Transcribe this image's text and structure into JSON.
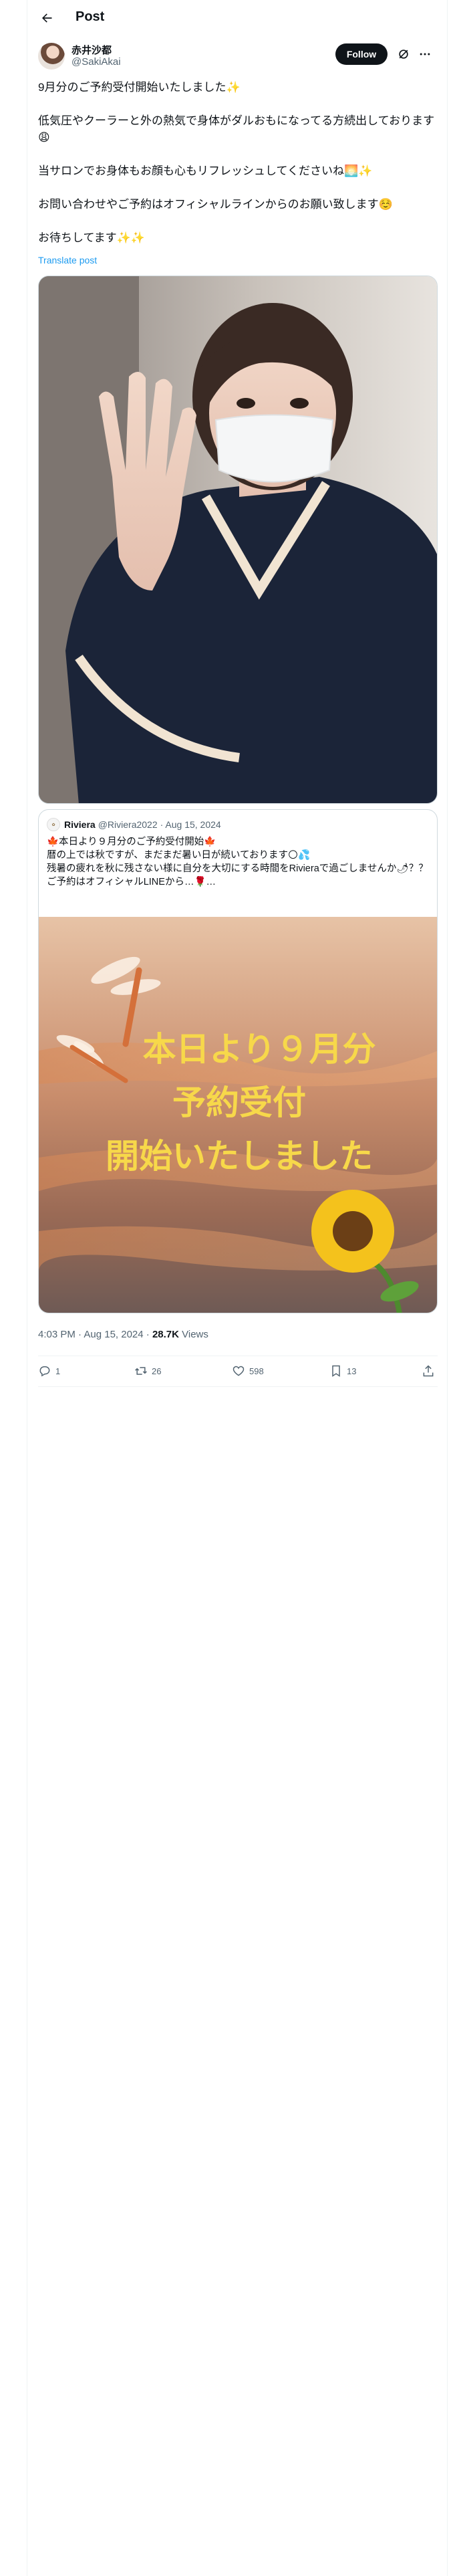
{
  "header": {
    "title": "Post"
  },
  "author": {
    "name": "赤井沙都",
    "handle": "@SakiAkai",
    "follow_label": "Follow"
  },
  "tweet": {
    "paragraphs": [
      "9月分のご予約受付開始いたしました✨",
      "低気圧やクーラーと外の熱気で身体がダルおもになってる方続出しております😩",
      "当サロンでお身体もお顔も心もリフレッシュしてくださいね🌅✨",
      "お問い合わせやご予約はオフィシャルラインからのお願い致します☺️",
      "お待ちしてます✨✨"
    ],
    "translate_label": "Translate post"
  },
  "quote": {
    "name": "Riviera",
    "handle": "@Riviera2022",
    "date": "· Aug 15, 2024",
    "text": "🍁本日より９月分のご予約受付開始🍁\n暦の上では秋ですが、まだまだ暑い日が続いております🌕💦\n残暑の疲れを秋に残さない様に自分を大切にする時間をRivieraで過ごしませんか🌶？？\nご予約はオフィシャルLINEから…🌹…",
    "image_text": [
      "本日より９月分",
      "予約受付",
      "開始いたしました"
    ]
  },
  "meta": {
    "time": "4:03 PM · Aug 15, 2024 · ",
    "views_count": "28.7K",
    "views_label": " Views"
  },
  "actions": {
    "replies": "1",
    "reposts": "26",
    "likes": "598",
    "bookmarks": "13"
  },
  "icons": {
    "back": "arrow-left-icon",
    "grok": "grok-icon",
    "more": "more-icon",
    "reply": "reply-icon",
    "repost": "repost-icon",
    "like": "heart-icon",
    "bookmark": "bookmark-icon",
    "share": "share-icon"
  },
  "colors": {
    "accent": "#1d9bf0",
    "text": "#0f1419",
    "muted": "#536471",
    "border": "#cfd9de",
    "follow_bg": "#0f1419",
    "quote_text_yellow": "#f7d84a"
  }
}
